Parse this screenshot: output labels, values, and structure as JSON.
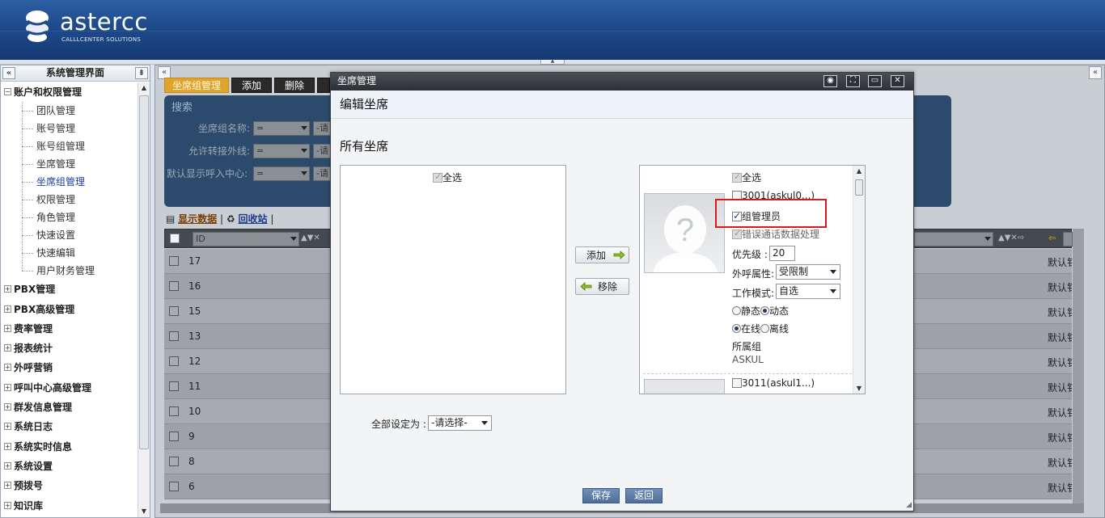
{
  "app": {
    "logo_name": "astercc",
    "logo_sub": "CALLLCENTER SOLUTIONS"
  },
  "sidebar": {
    "title": "系统管理界面",
    "collapse_icon": "«",
    "pin_icon": "⇟",
    "tree": [
      {
        "label": "账户和权限管理",
        "expanded": true,
        "children": [
          "团队管理",
          "账号管理",
          "账号组管理",
          "坐席管理",
          "坐席组管理",
          "权限管理",
          "角色管理",
          "快速设置",
          "快速编辑",
          "用户财务管理"
        ],
        "active_child": "坐席组管理"
      },
      {
        "label": "PBX管理"
      },
      {
        "label": "PBX高级管理"
      },
      {
        "label": "费率管理"
      },
      {
        "label": "报表统计"
      },
      {
        "label": "外呼营销"
      },
      {
        "label": "呼叫中心高级管理"
      },
      {
        "label": "群发信息管理"
      },
      {
        "label": "系统日志"
      },
      {
        "label": "系统实时信息"
      },
      {
        "label": "系统设置"
      },
      {
        "label": "预拨号"
      },
      {
        "label": "知识库"
      }
    ]
  },
  "main": {
    "toolbar": {
      "tab_label": "坐席组管理",
      "add": "添加",
      "delete": "删除"
    },
    "search": {
      "title": "搜索",
      "fields": [
        {
          "label": "坐席组名称:",
          "operator": "=",
          "value": "-请"
        },
        {
          "label": "允许转接外线:",
          "operator": "=",
          "value": "-请"
        },
        {
          "label": "默认显示呼入中心:",
          "operator": "=",
          "value": "-请"
        }
      ]
    },
    "links": {
      "show_data": "显示数据",
      "recycle": "回收站",
      "sep": "|"
    },
    "grid": {
      "column": "ID",
      "rows": [
        "17",
        "16",
        "15",
        "13",
        "12",
        "11",
        "10",
        "9",
        "8",
        "6"
      ],
      "tail_text": "默认钅"
    }
  },
  "dialog": {
    "title": "坐席管理",
    "subtitle": "编辑坐席",
    "section": "所有坐席",
    "left_select_all": "全选",
    "add_button": "添加",
    "remove_button": "移除",
    "right_select_all": "全选",
    "agent1": {
      "name": "3001(askul0...)",
      "group_admin_label": "组管理员",
      "group_admin_checked": true,
      "error_call_label": "错误通话数据处理",
      "error_call_checked": true,
      "priority_label": "优先级 :",
      "priority_value": "20",
      "outbound_label": "外呼属性:",
      "outbound_value": "受限制",
      "work_mode_label": "工作模式:",
      "work_mode_value": "自选",
      "static_label": "静态",
      "dynamic_label": "动态",
      "online_label": "在线",
      "offline_label": "离线",
      "group_label": "所属组",
      "group_value": "ASKUL"
    },
    "agent2": {
      "name": "3011(askul1...)"
    },
    "set_all_label": "全部设定为 :",
    "set_all_value": "-请选择-",
    "save_button": "保存",
    "back_button": "返回"
  }
}
